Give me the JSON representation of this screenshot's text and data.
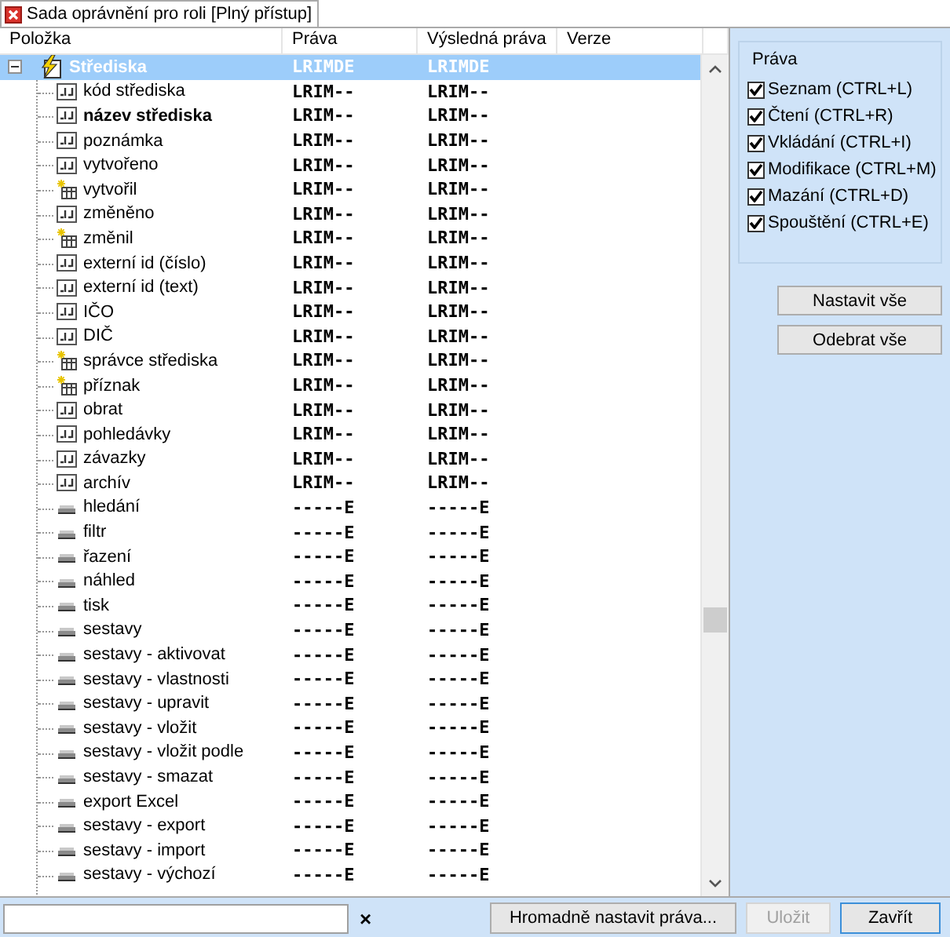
{
  "tab": {
    "label": "Sada oprávnění pro roli [Plný přístup]",
    "selected": true
  },
  "tree": {
    "columns": [
      "Položka",
      "Práva",
      "Výsledná práva",
      "Verze"
    ],
    "rows": [
      {
        "name": "Střediska",
        "kind": "group",
        "rights": "LRIMDE",
        "result": "LRIMDE",
        "selected": true,
        "expanded": true,
        "children": [
          {
            "name": "kód střediska",
            "kind": "field",
            "rights": "LRIM--",
            "result": "LRIM--",
            "selected": false,
            "bold": false
          },
          {
            "name": "název střediska",
            "kind": "field",
            "rights": "LRIM--",
            "result": "LRIM--",
            "selected": false,
            "bold": true
          },
          {
            "name": "poznámka",
            "kind": "field",
            "rights": "LRIM--",
            "result": "LRIM--",
            "selected": false,
            "bold": false
          },
          {
            "name": "vytvořeno",
            "kind": "field",
            "rights": "LRIM--",
            "result": "LRIM--",
            "selected": false,
            "bold": false
          },
          {
            "name": "vytvořil",
            "kind": "lookup",
            "rights": "LRIM--",
            "result": "LRIM--",
            "selected": false,
            "bold": false
          },
          {
            "name": "změněno",
            "kind": "field",
            "rights": "LRIM--",
            "result": "LRIM--",
            "selected": false,
            "bold": false
          },
          {
            "name": "změnil",
            "kind": "lookup",
            "rights": "LRIM--",
            "result": "LRIM--",
            "selected": false,
            "bold": false
          },
          {
            "name": "externí id (číslo)",
            "kind": "field",
            "rights": "LRIM--",
            "result": "LRIM--",
            "selected": false,
            "bold": false
          },
          {
            "name": "externí id (text)",
            "kind": "field",
            "rights": "LRIM--",
            "result": "LRIM--",
            "selected": false,
            "bold": false
          },
          {
            "name": "IČO",
            "kind": "field",
            "rights": "LRIM--",
            "result": "LRIM--",
            "selected": false,
            "bold": false
          },
          {
            "name": "DIČ",
            "kind": "field",
            "rights": "LRIM--",
            "result": "LRIM--",
            "selected": false,
            "bold": false
          },
          {
            "name": "správce střediska",
            "kind": "lookup",
            "rights": "LRIM--",
            "result": "LRIM--",
            "selected": false,
            "bold": false
          },
          {
            "name": "příznak",
            "kind": "lookup",
            "rights": "LRIM--",
            "result": "LRIM--",
            "selected": false,
            "bold": false
          },
          {
            "name": "obrat",
            "kind": "field",
            "rights": "LRIM--",
            "result": "LRIM--",
            "selected": false,
            "bold": false
          },
          {
            "name": "pohledávky",
            "kind": "field",
            "rights": "LRIM--",
            "result": "LRIM--",
            "selected": false,
            "bold": false
          },
          {
            "name": "závazky",
            "kind": "field",
            "rights": "LRIM--",
            "result": "LRIM--",
            "selected": false,
            "bold": false
          },
          {
            "name": "archív",
            "kind": "field",
            "rights": "LRIM--",
            "result": "LRIM--",
            "selected": false,
            "bold": false
          },
          {
            "name": "hledání",
            "kind": "action",
            "rights": "-----E",
            "result": "-----E",
            "selected": false,
            "bold": false
          },
          {
            "name": "filtr",
            "kind": "action",
            "rights": "-----E",
            "result": "-----E",
            "selected": false,
            "bold": false
          },
          {
            "name": "řazení",
            "kind": "action",
            "rights": "-----E",
            "result": "-----E",
            "selected": false,
            "bold": false
          },
          {
            "name": "náhled",
            "kind": "action",
            "rights": "-----E",
            "result": "-----E",
            "selected": false,
            "bold": false
          },
          {
            "name": "tisk",
            "kind": "action",
            "rights": "-----E",
            "result": "-----E",
            "selected": false,
            "bold": false
          },
          {
            "name": "sestavy",
            "kind": "action",
            "rights": "-----E",
            "result": "-----E",
            "selected": false,
            "bold": false
          },
          {
            "name": "sestavy - aktivovat",
            "kind": "action",
            "rights": "-----E",
            "result": "-----E",
            "selected": false,
            "bold": false
          },
          {
            "name": "sestavy - vlastnosti",
            "kind": "action",
            "rights": "-----E",
            "result": "-----E",
            "selected": false,
            "bold": false
          },
          {
            "name": "sestavy - upravit",
            "kind": "action",
            "rights": "-----E",
            "result": "-----E",
            "selected": false,
            "bold": false
          },
          {
            "name": "sestavy - vložit",
            "kind": "action",
            "rights": "-----E",
            "result": "-----E",
            "selected": false,
            "bold": false
          },
          {
            "name": "sestavy - vložit podle",
            "kind": "action",
            "rights": "-----E",
            "result": "-----E",
            "selected": false,
            "bold": false
          },
          {
            "name": "sestavy - smazat",
            "kind": "action",
            "rights": "-----E",
            "result": "-----E",
            "selected": false,
            "bold": false
          },
          {
            "name": "export Excel",
            "kind": "action",
            "rights": "-----E",
            "result": "-----E",
            "selected": false,
            "bold": false
          },
          {
            "name": "sestavy - export",
            "kind": "action",
            "rights": "-----E",
            "result": "-----E",
            "selected": false,
            "bold": false
          },
          {
            "name": "sestavy - import",
            "kind": "action",
            "rights": "-----E",
            "result": "-----E",
            "selected": false,
            "bold": false
          },
          {
            "name": "sestavy - výchozí",
            "kind": "action",
            "rights": "-----E",
            "result": "-----E",
            "selected": false,
            "bold": false
          }
        ]
      }
    ]
  },
  "rights_panel": {
    "title": "Práva",
    "options": [
      {
        "label": "Seznam (CTRL+L)",
        "checked": true
      },
      {
        "label": "Čtení (CTRL+R)",
        "checked": true
      },
      {
        "label": "Vkládání (CTRL+I)",
        "checked": true
      },
      {
        "label": "Modifikace (CTRL+M)",
        "checked": true
      },
      {
        "label": "Mazání (CTRL+D)",
        "checked": true
      },
      {
        "label": "Spouštění (CTRL+E)",
        "checked": true
      }
    ],
    "buttons": [
      "Nastavit vše",
      "Odebrat vše"
    ]
  },
  "footer": {
    "clear": "×",
    "buttons": [
      {
        "label": "Hromadně nastavit práva...",
        "disabled": false,
        "default": false
      },
      {
        "label": "Uložit",
        "disabled": true,
        "default": false
      },
      {
        "label": "Zavřít",
        "disabled": false,
        "default": true
      }
    ]
  }
}
